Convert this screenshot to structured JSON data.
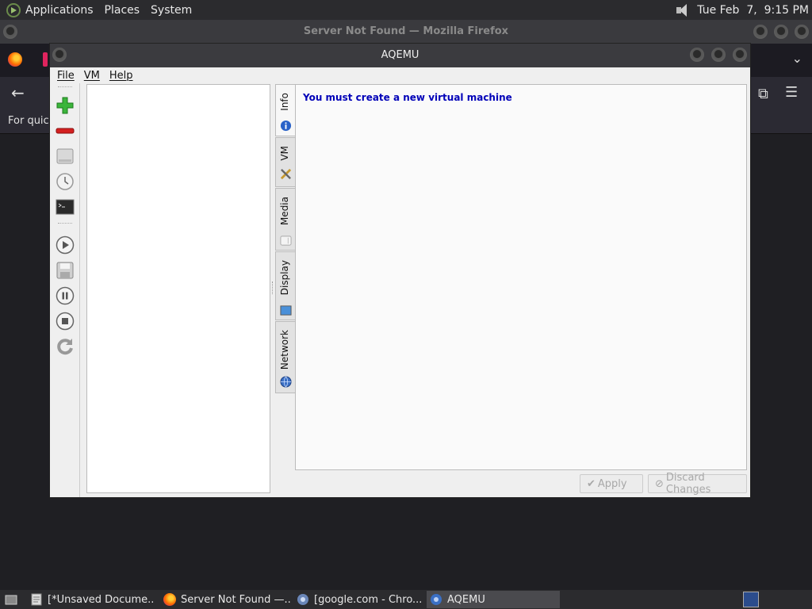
{
  "top_panel": {
    "menus": [
      "Applications",
      "Places",
      "System"
    ],
    "clock": "Tue Feb  7,  9:15 PM"
  },
  "firefox": {
    "window_title": "Server Not Found — Mozilla Firefox",
    "bookmarks_hint": "For quick"
  },
  "aqemu": {
    "window_title": "AQEMU",
    "menu": [
      "File",
      "VM",
      "Help"
    ],
    "toolbar_icons": [
      "add-vm-icon",
      "remove-vm-icon",
      "disk-icon",
      "clock-icon",
      "terminal-icon",
      "play-icon",
      "save-icon",
      "pause-icon",
      "stop-icon",
      "reload-icon"
    ],
    "tabs": [
      "Info",
      "VM",
      "Media",
      "Display",
      "Network"
    ],
    "info_message": "You must create a new virtual machine",
    "apply_label": "Apply",
    "discard_label": "Discard Changes"
  },
  "taskbar": {
    "tasks": [
      "[*Unsaved Docume...",
      "Server Not Found —...",
      "[google.com - Chro...",
      "AQEMU"
    ]
  },
  "colors": {
    "info_text": "#0000b8",
    "panel_bg": "#2b2b2e",
    "desktop_bg": "#1f1f23"
  }
}
